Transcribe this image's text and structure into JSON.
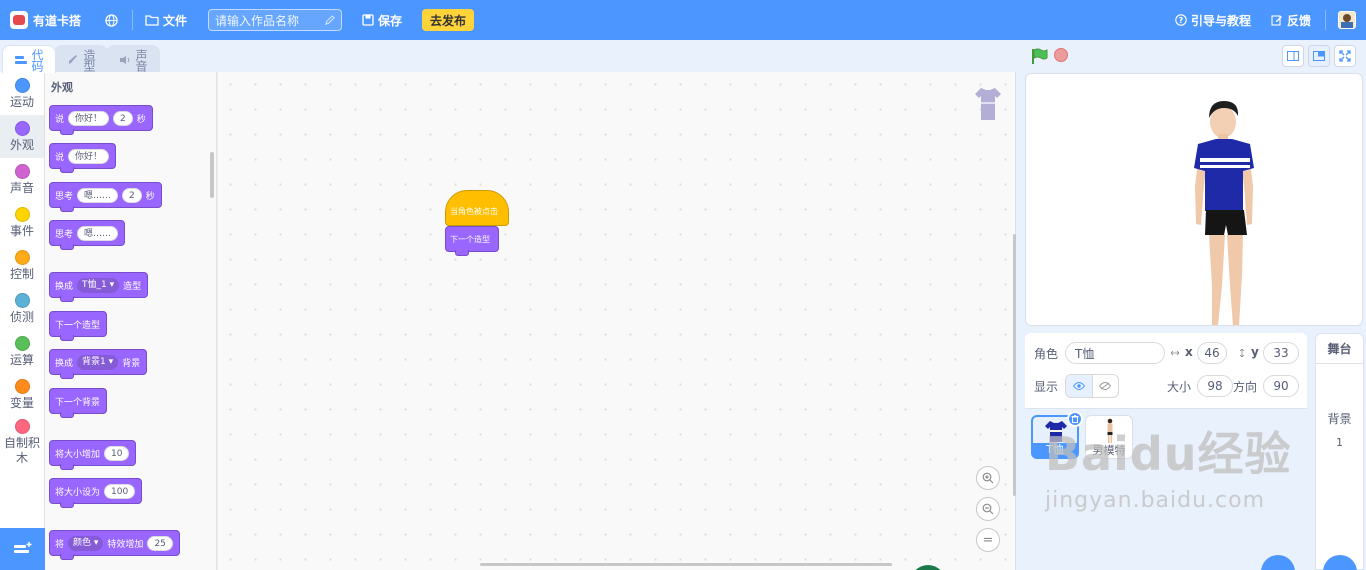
{
  "header": {
    "logo_text": "有道卡搭",
    "file_menu": "文件",
    "title_placeholder": "请输入作品名称",
    "save_label": "保存",
    "publish_label": "去发布",
    "guide_label": "引导与教程",
    "feedback_label": "反馈",
    "brand_color": "#4c97ff"
  },
  "tabs": [
    {
      "label": "代码",
      "icon": "code-icon",
      "active": true
    },
    {
      "label": "造型",
      "icon": "brush-icon",
      "active": false
    },
    {
      "label": "声音",
      "icon": "speaker-icon",
      "active": false
    }
  ],
  "categories": [
    {
      "label": "运动",
      "color": "#4c97ff"
    },
    {
      "label": "外观",
      "color": "#9966ff",
      "active": true
    },
    {
      "label": "声音",
      "color": "#cf63cf"
    },
    {
      "label": "事件",
      "color": "#ffd500"
    },
    {
      "label": "控制",
      "color": "#ffab19"
    },
    {
      "label": "侦测",
      "color": "#5cb1d6"
    },
    {
      "label": "运算",
      "color": "#59c059"
    },
    {
      "label": "变量",
      "color": "#ff8c1a"
    },
    {
      "label": "自制积木",
      "color": "#ff6680"
    }
  ],
  "palette": {
    "title": "外观",
    "blocks": {
      "say_secs": {
        "a": "说",
        "b": "你好！",
        "c": "2",
        "d": "秒"
      },
      "say": {
        "a": "说",
        "b": "你好！"
      },
      "think_secs": {
        "a": "思考",
        "b": "嗯……",
        "c": "2",
        "d": "秒"
      },
      "think": {
        "a": "思考",
        "b": "嗯……"
      },
      "switch_costume": {
        "a": "换成",
        "b": "T恤_1",
        "c": "造型"
      },
      "next_costume": {
        "a": "下一个造型"
      },
      "switch_backdrop": {
        "a": "换成",
        "b": "背景1",
        "c": "背景"
      },
      "next_backdrop": {
        "a": "下一个背景"
      },
      "change_size": {
        "a": "将大小增加",
        "b": "10"
      },
      "set_size": {
        "a": "将大小设为",
        "b": "100"
      },
      "change_effect": {
        "a": "将",
        "b": "颜色",
        "c": "特效增加",
        "d": "25"
      }
    }
  },
  "script": {
    "hat_block": "当角色被点击",
    "stack_block": "下一个造型",
    "zoom_reset": "="
  },
  "sprite_info": {
    "sprite_label": "角色",
    "sprite_name": "T恤",
    "x_label": "x",
    "x": "46",
    "y_label": "y",
    "y": "33",
    "show_label": "显示",
    "size_label": "大小",
    "size": "98",
    "direction_label": "方向",
    "direction": "90"
  },
  "sprites": [
    {
      "name": "T恤",
      "selected": true
    },
    {
      "name": "男模特",
      "selected": false
    }
  ],
  "stage_panel": {
    "title": "舞台",
    "backdrops_label": "背景",
    "backdrops_count": "1"
  },
  "watermark": {
    "main": "Baidu经验",
    "sub": "jingyan.baidu.com"
  }
}
